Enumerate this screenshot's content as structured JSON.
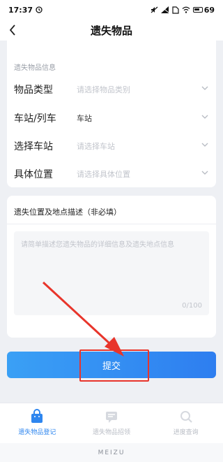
{
  "status_bar": {
    "time": "17:37",
    "battery": "69"
  },
  "header": {
    "title": "遗失物品"
  },
  "form": {
    "section_label": "遗失物品信息",
    "rows": [
      {
        "label": "物品类型",
        "value": "请选择物品类别",
        "filled": false
      },
      {
        "label": "车站/列车",
        "value": "车站",
        "filled": true
      },
      {
        "label": "选择车站",
        "value": "请选择车站",
        "filled": false
      },
      {
        "label": "具体位置",
        "value": "请选择具体位置",
        "filled": false
      }
    ]
  },
  "description": {
    "label": "遗失位置及地点描述（非必填）",
    "placeholder": "请简单描述您遗失物品的详细信息及遗失地点信息",
    "counter": "0/100"
  },
  "submit": {
    "label": "提交"
  },
  "bottom_nav": {
    "items": [
      {
        "label": "遗失物品登记",
        "icon": "bag-icon",
        "active": true
      },
      {
        "label": "遗失物品招领",
        "icon": "message-icon",
        "active": false
      },
      {
        "label": "进度查询",
        "icon": "search-icon",
        "active": false
      }
    ]
  },
  "brand": "MEIZU",
  "colors": {
    "accent": "#2e86ef",
    "highlight": "#e8352b"
  }
}
